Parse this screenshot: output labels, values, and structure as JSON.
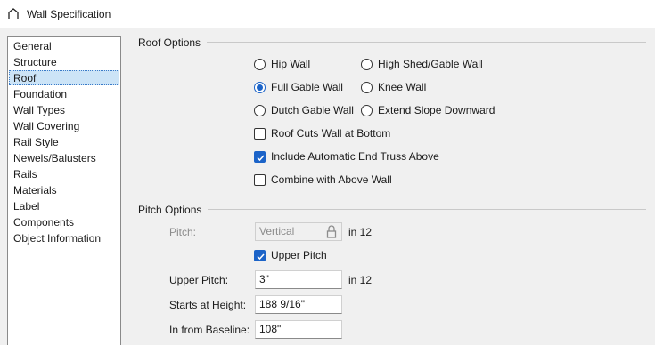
{
  "window": {
    "title": "Wall Specification"
  },
  "nav": {
    "items": [
      {
        "label": "General"
      },
      {
        "label": "Structure"
      },
      {
        "label": "Roof",
        "selected": true
      },
      {
        "label": "Foundation"
      },
      {
        "label": "Wall Types"
      },
      {
        "label": "Wall Covering"
      },
      {
        "label": "Rail Style"
      },
      {
        "label": "Newels/Balusters"
      },
      {
        "label": "Rails"
      },
      {
        "label": "Materials"
      },
      {
        "label": "Label"
      },
      {
        "label": "Components"
      },
      {
        "label": "Object Information"
      }
    ]
  },
  "roof_options": {
    "heading": "Roof Options",
    "radios": [
      {
        "label": "Hip Wall",
        "checked": false
      },
      {
        "label": "High Shed/Gable Wall",
        "checked": false
      },
      {
        "label": "Full Gable Wall",
        "checked": true
      },
      {
        "label": "Knee Wall",
        "checked": false
      },
      {
        "label": "Dutch Gable Wall",
        "checked": false
      },
      {
        "label": "Extend Slope Downward",
        "checked": false
      }
    ],
    "checkboxes": [
      {
        "label": "Roof Cuts Wall at Bottom",
        "checked": false
      },
      {
        "label": "Include Automatic End Truss Above",
        "checked": true
      },
      {
        "label": "Combine with Above Wall",
        "checked": false
      }
    ]
  },
  "pitch_options": {
    "heading": "Pitch Options",
    "pitch": {
      "label": "Pitch:",
      "value": "Vertical",
      "unit": "in 12",
      "disabled": true
    },
    "upper_pitch_checkbox": {
      "label": "Upper Pitch",
      "checked": true
    },
    "upper_pitch": {
      "label": "Upper Pitch:",
      "value": "3\"",
      "unit": "in 12"
    },
    "starts_at_height": {
      "label": "Starts at Height:",
      "value": "188 9/16\""
    },
    "in_from_baseline": {
      "label": "In from Baseline:",
      "value": "108\""
    }
  },
  "colors": {
    "accent": "#1b63c8",
    "selection": "#cce4f7"
  }
}
